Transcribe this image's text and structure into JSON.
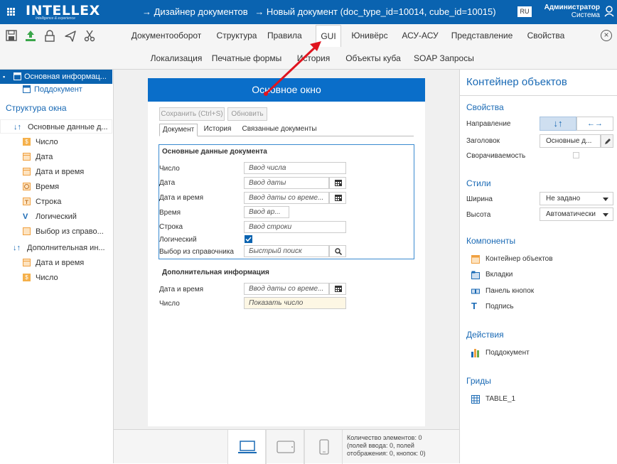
{
  "header": {
    "logo": "INTELLEX",
    "logo_tagline": "Intelligence & experience",
    "breadcrumb": [
      "→ Дизайнер документов",
      "→ Новый документ (doc_type_id=10014, cube_id=10015)"
    ],
    "lang": "RU",
    "user_name": "Администратор",
    "user_role": "Система"
  },
  "toolbar": {
    "icons": [
      "save-icon",
      "upload-icon",
      "lock-icon",
      "send-icon",
      "cut-icon"
    ],
    "tabs_row1": [
      "Документооборот",
      "Структура",
      "Правила",
      "GUI",
      "Юнивёрс",
      "АСУ-АСУ",
      "Представление",
      "Свойства"
    ],
    "tabs_row2": [
      "Локализация",
      "Печатные формы",
      "История",
      "Объекты куба",
      "SOAP Запросы"
    ],
    "active_tab": "GUI"
  },
  "left_panel": {
    "top_items": [
      {
        "label": "Основная информац...",
        "selected": true
      },
      {
        "label": "Поддокумент",
        "selected": false
      }
    ],
    "structure_title": "Структура окна",
    "group1_label": "Основные данные д...",
    "group1_items": [
      "Число",
      "Дата",
      "Дата и время",
      "Время",
      "Строка",
      "Логический",
      "Выбор из справо..."
    ],
    "group2_label": "Дополнительная ин...",
    "group2_items": [
      "Дата и время",
      "Число"
    ]
  },
  "canvas": {
    "header": "Основное окно",
    "save_button": "Сохранить (Ctrl+S)",
    "refresh_button": "Обновить",
    "tabs": [
      "Документ",
      "История",
      "Связанные документы"
    ],
    "group1": {
      "title": "Основные данные документа",
      "fields": [
        {
          "label": "Число",
          "placeholder": "Ввод числа"
        },
        {
          "label": "Дата",
          "placeholder": "Ввод даты"
        },
        {
          "label": "Дата и время",
          "placeholder": "Ввод даты со време..."
        },
        {
          "label": "Время",
          "placeholder": "Ввод вр..."
        },
        {
          "label": "Строка",
          "placeholder": "Ввод строки"
        },
        {
          "label": "Логический",
          "placeholder": ""
        },
        {
          "label": "Выбор из справочника",
          "placeholder": "Быстрый поиск"
        }
      ]
    },
    "group2": {
      "title": "Дополнительная информация",
      "fields": [
        {
          "label": "Дата и время",
          "placeholder": "Ввод даты со време..."
        },
        {
          "label": "Число",
          "placeholder": "Показать число"
        }
      ]
    }
  },
  "status": {
    "line1": "Количество элементов: 0",
    "line2": "(полей ввода: 0, полей",
    "line3": "отображения: 0, кнопок: 0)"
  },
  "right_panel": {
    "title": "Контейнер объектов",
    "properties_title": "Свойства",
    "direction_label": "Направление",
    "direction_vertical": "↓↑",
    "direction_horizontal": "←→",
    "caption_label": "Заголовок",
    "caption_value": "Основные д...",
    "collapsible_label": "Сворачиваемость",
    "styles_title": "Стили",
    "width_label": "Ширина",
    "width_value": "Не задано",
    "height_label": "Высота",
    "height_value": "Автоматически",
    "components_title": "Компоненты",
    "components": [
      "Контейнер объектов",
      "Вкладки",
      "Панель кнопок",
      "Подпись"
    ],
    "actions_title": "Действия",
    "actions": [
      "Поддокумент"
    ],
    "grids_title": "Гриды",
    "grids": [
      "TABLE_1"
    ]
  },
  "colors": {
    "brand": "#0a63b0",
    "annotation_arrow": "#e0141e"
  }
}
